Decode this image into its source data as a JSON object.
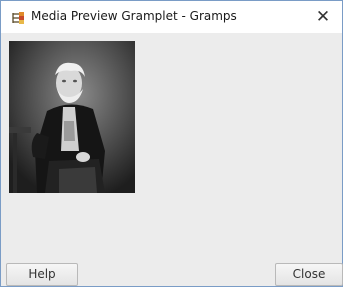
{
  "window": {
    "title": "Media Preview Gramplet - Gramps",
    "close_glyph": "✕",
    "app_icon": "gramps-tree-icon"
  },
  "media": {
    "icon": "photo-preview-icon"
  },
  "buttons": {
    "help_label": "Help",
    "close_label": "Close"
  },
  "colors": {
    "window_border": "#7a9cc6",
    "background": "#ececec",
    "titlebar": "#ffffff"
  }
}
